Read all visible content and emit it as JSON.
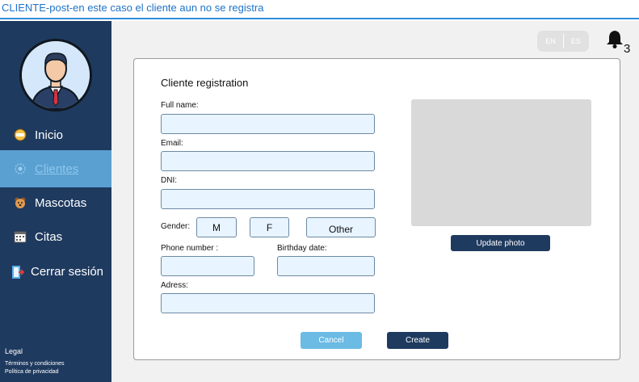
{
  "page_title": "CLIENTE-post-en este caso el cliente aun no se registra",
  "sidebar": {
    "items": [
      {
        "label": "Inicio",
        "icon": "start-icon"
      },
      {
        "label": "Clientes",
        "icon": "clients-icon",
        "active": true
      },
      {
        "label": "Mascotas",
        "icon": "pet-icon"
      },
      {
        "label": "Citas",
        "icon": "calendar-icon"
      },
      {
        "label": "Cerrar sesión",
        "icon": "logout-icon"
      }
    ],
    "legal": "Legal",
    "terms": "Términos y condiciones",
    "privacy": "Política de privacidad"
  },
  "header": {
    "lang_en": "EN",
    "lang_es": "ES",
    "notification_count": "3"
  },
  "form": {
    "title": "Cliente registration",
    "full_name_label": "Full name:",
    "full_name_value": "",
    "email_label": "Email:",
    "email_value": "",
    "dni_label": "DNI:",
    "dni_value": "",
    "gender_label": "Gender:",
    "gender_options": [
      "M",
      "F",
      "Other"
    ],
    "phone_label": "Phone number :",
    "phone_value": "",
    "birthday_label": "Birthday date:",
    "birthday_value": "",
    "address_label": "Adress:",
    "address_value": "",
    "update_photo_label": "Update photo",
    "cancel_label": "Cancel",
    "create_label": "Create"
  },
  "colors": {
    "sidebar_bg": "#1f3a5f",
    "active_item_bg": "#5aa0d0",
    "accent_blue": "#2f8fd8",
    "field_bg": "#e8f4ff",
    "cancel_bg": "#6bbbe5",
    "dark_button_bg": "#1f3a5f"
  }
}
